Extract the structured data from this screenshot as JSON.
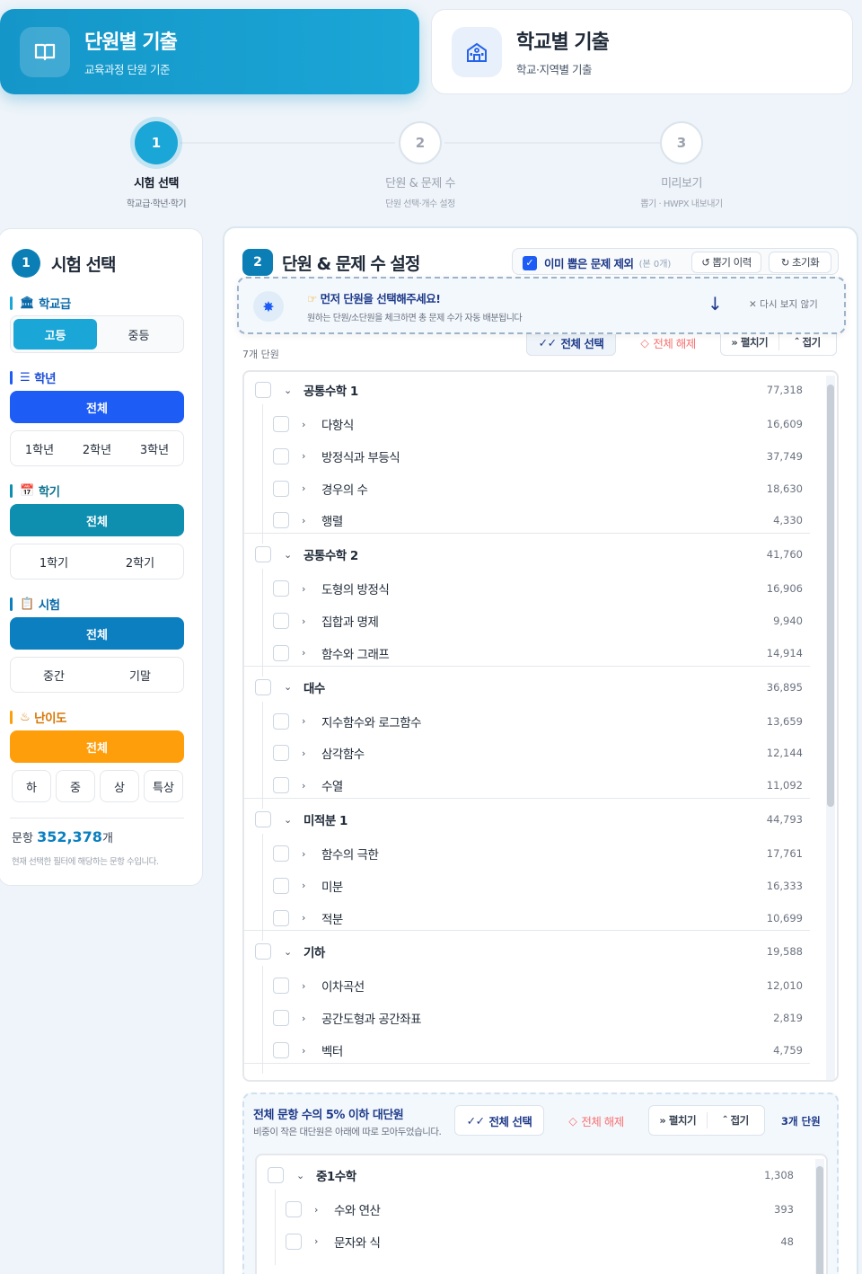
{
  "modes": {
    "unit": {
      "title": "단원별 기출",
      "subtitle": "교육과정 단원 기준"
    },
    "school": {
      "title": "학교별 기출",
      "subtitle": "학교·지역별 기출"
    }
  },
  "steps": [
    {
      "num": "1",
      "label": "시험 선택",
      "sub": "학교급·학년·학기"
    },
    {
      "num": "2",
      "label": "단원 & 문제 수",
      "sub": "단원 선택·개수 설정"
    },
    {
      "num": "3",
      "label": "미리보기",
      "sub": "뽑기 · HWPX 내보내기"
    }
  ],
  "left": {
    "num": "1",
    "title": "시험 선택",
    "school_level": {
      "label": "학교급",
      "options": [
        "고등",
        "중등"
      ],
      "selected": "고등"
    },
    "grade": {
      "label": "학년",
      "all": "전체",
      "options": [
        "1학년",
        "2학년",
        "3학년"
      ]
    },
    "semester": {
      "label": "학기",
      "all": "전체",
      "options": [
        "1학기",
        "2학기"
      ]
    },
    "exam": {
      "label": "시험",
      "all": "전체",
      "options": [
        "중간",
        "기말"
      ]
    },
    "difficulty": {
      "label": "난이도",
      "all": "전체",
      "options": [
        "하",
        "중",
        "상",
        "특상"
      ]
    },
    "count_prefix": "문항",
    "count_value": "352,378",
    "count_suffix": "개",
    "count_note": "현재 선택한 필터에 해당하는 문항 수입니다."
  },
  "main": {
    "num": "2",
    "title": "단원 & 문제 수 설정",
    "exclude_label": "이미 뽑은 문제 제외",
    "exclude_count": "(본 0개)",
    "history_btn": "뽑기 이력",
    "reset_btn": "초기화",
    "toast_title": "먼저 단원을 선택해주세요!",
    "toast_sub": "원하는 단원/소단원을 체크하면 총 문제 수가 자동 배분됩니다",
    "toast_close": "다시 보지 않기",
    "unit_count": "7개 단원",
    "select_all": "전체 선택",
    "deselect_all": "전체 해제",
    "expand": "펼치기",
    "collapse": "접기",
    "groups": [
      {
        "name": "공통수학 1",
        "count": "77,318",
        "items": [
          {
            "name": "다항식",
            "count": "16,609"
          },
          {
            "name": "방정식과 부등식",
            "count": "37,749"
          },
          {
            "name": "경우의 수",
            "count": "18,630"
          },
          {
            "name": "행렬",
            "count": "4,330"
          }
        ]
      },
      {
        "name": "공통수학 2",
        "count": "41,760",
        "items": [
          {
            "name": "도형의 방정식",
            "count": "16,906"
          },
          {
            "name": "집합과 명제",
            "count": "9,940"
          },
          {
            "name": "함수와 그래프",
            "count": "14,914"
          }
        ]
      },
      {
        "name": "대수",
        "count": "36,895",
        "items": [
          {
            "name": "지수함수와 로그함수",
            "count": "13,659"
          },
          {
            "name": "삼각함수",
            "count": "12,144"
          },
          {
            "name": "수열",
            "count": "11,092"
          }
        ]
      },
      {
        "name": "미적분 1",
        "count": "44,793",
        "items": [
          {
            "name": "함수의 극한",
            "count": "17,761"
          },
          {
            "name": "미분",
            "count": "16,333"
          },
          {
            "name": "적분",
            "count": "10,699"
          }
        ]
      },
      {
        "name": "기하",
        "count": "19,588",
        "items": [
          {
            "name": "이차곡선",
            "count": "12,010"
          },
          {
            "name": "공간도형과 공간좌표",
            "count": "2,819"
          },
          {
            "name": "벡터",
            "count": "4,759"
          }
        ]
      }
    ],
    "small": {
      "title": "전체 문항 수의 5% 이하 대단원",
      "sub": "비중이 작은 대단원은 아래에 따로 모아두었습니다.",
      "select_all": "전체 선택",
      "deselect_all": "전체 해제",
      "expand": "펼치기",
      "collapse": "접기",
      "unit_count": "3개 단원",
      "groups": [
        {
          "name": "중1수학",
          "count": "1,308",
          "items": [
            {
              "name": "수와 연산",
              "count": "393"
            },
            {
              "name": "문자와 식",
              "count": "48"
            }
          ]
        }
      ]
    }
  },
  "colors": {
    "accent": "#1aa6d6",
    "blue": "#1d5cf5",
    "teal": "#0e8fb0",
    "exam": "#0b7fbf",
    "orange": "#ff9e0b",
    "red": "#ef4444"
  }
}
